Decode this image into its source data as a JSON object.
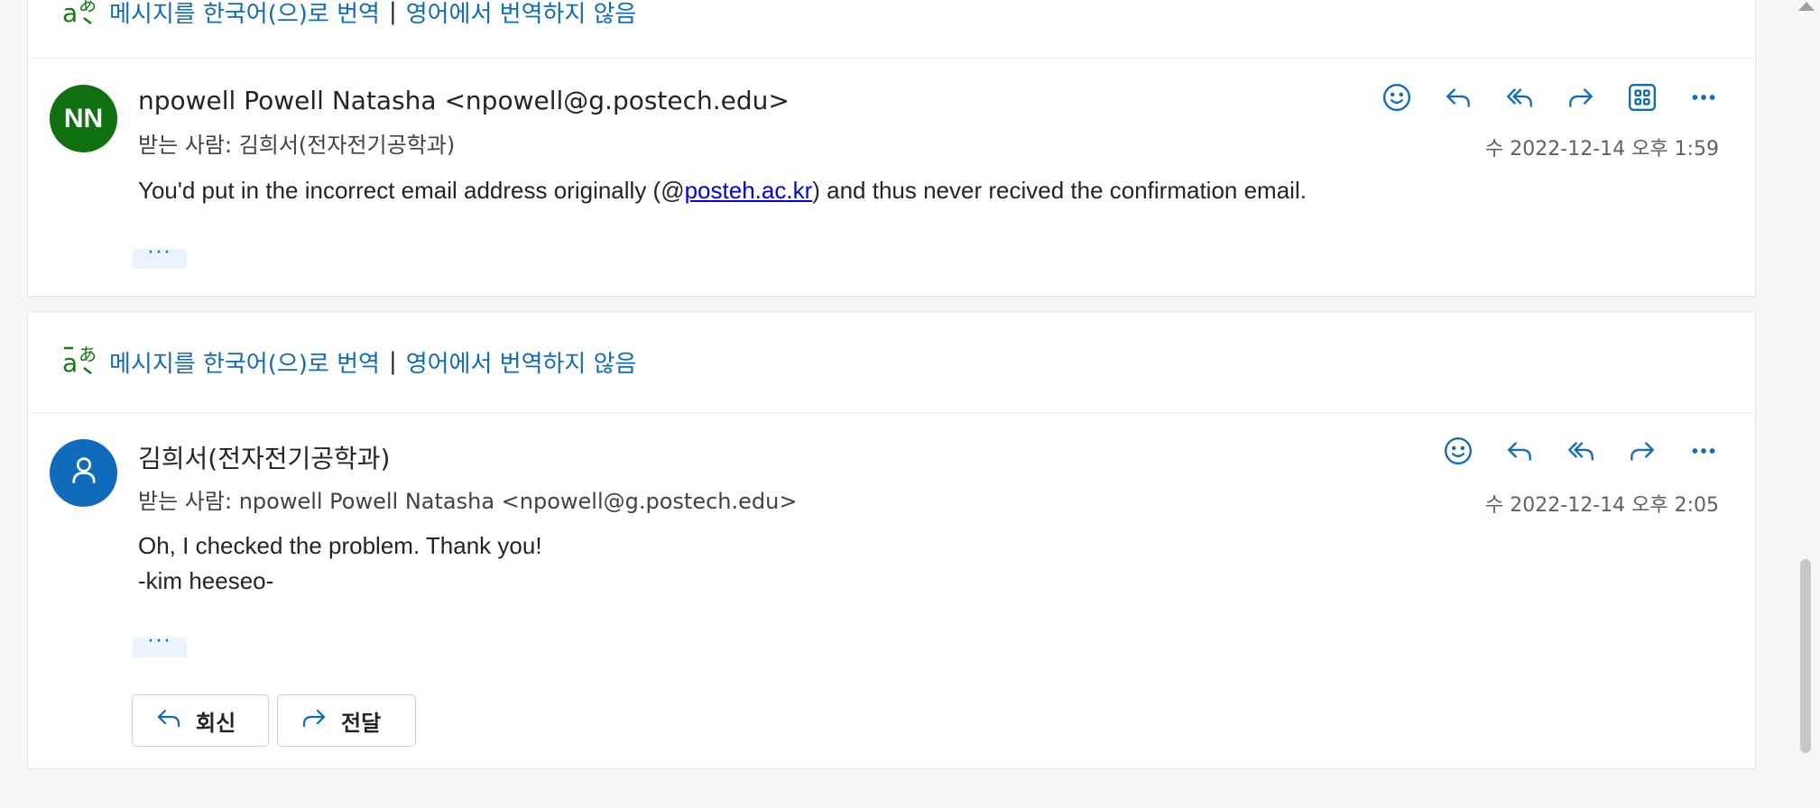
{
  "translate": {
    "translate_link": "메시지를 한국어(으)로 번역",
    "separator": "|",
    "dont_translate_link": "영어에서 번역하지 않음"
  },
  "messages": [
    {
      "avatar_initials": "NN",
      "avatar_color": "#0e700e",
      "sender": "npowell Powell Natasha <npowell@g.postech.edu>",
      "to_label": "받는 사람:",
      "to": "김희서(전자전기공학과)",
      "date": "수 2022-12-14 오후 1:59",
      "body_prefix": "You'd put in the incorrect email address originally (@",
      "body_link": "posteh.ac.kr",
      "body_suffix": ") and thus never recived the confirmation email.",
      "ellipsis": "···"
    },
    {
      "avatar_initials": "",
      "avatar_color": "#0f6cbd",
      "sender": "김희서(전자전기공학과)",
      "to_label": "받는 사람:",
      "to": "npowell Powell Natasha <npowell@g.postech.edu>",
      "date": "수 2022-12-14 오후 2:05",
      "body_line1": "Oh, I checked the problem. Thank you!",
      "body_line2": "-kim heeseo-",
      "ellipsis": "···"
    }
  ],
  "footer_buttons": {
    "reply": "회신",
    "forward": "전달"
  },
  "icons": [
    "translate-icon",
    "emoji-icon",
    "reply-icon",
    "reply-all-icon",
    "forward-icon",
    "apps-icon",
    "more-icon",
    "person-icon"
  ]
}
